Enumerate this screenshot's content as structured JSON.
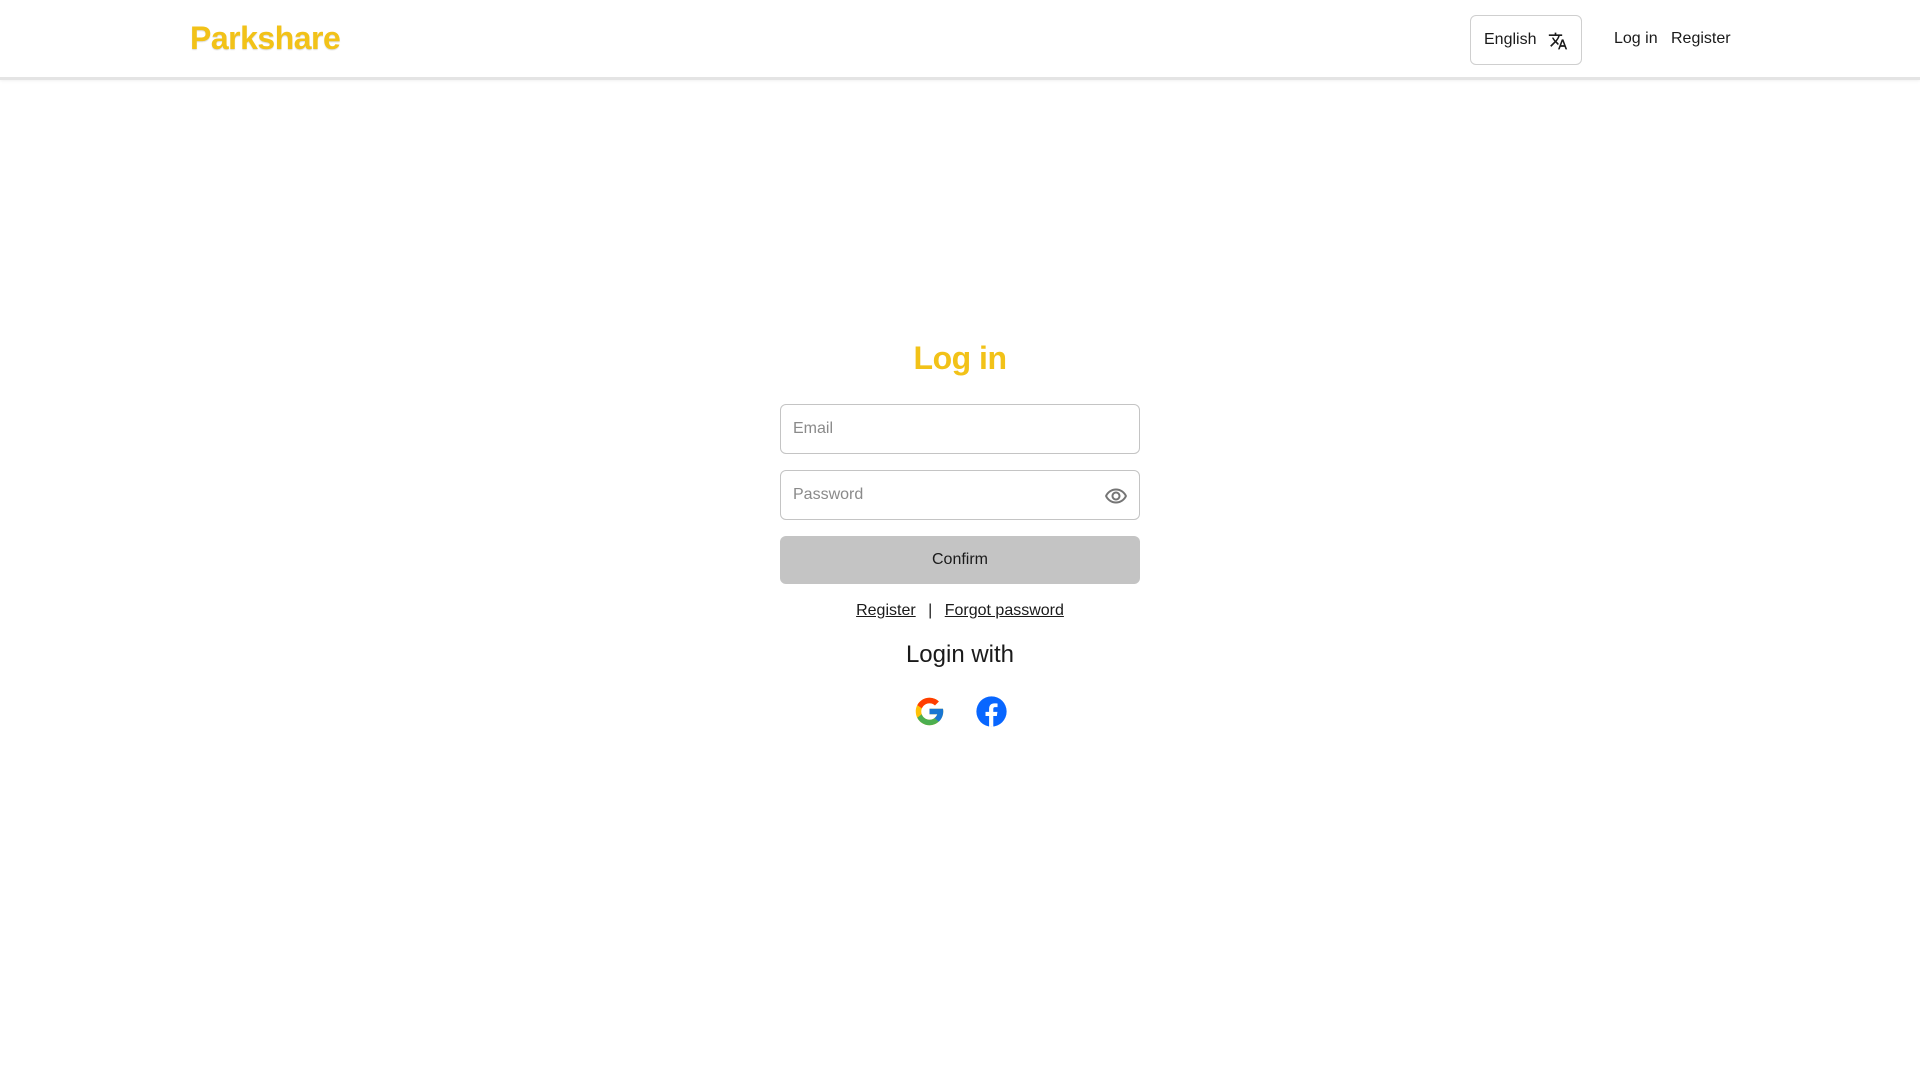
{
  "header": {
    "logo": "Parkshare",
    "language": {
      "selected": "English",
      "icon": "translate-icon"
    },
    "nav": {
      "login_label": "Log in",
      "register_label": "Register"
    }
  },
  "login": {
    "title": "Log in",
    "email": {
      "placeholder": "Email",
      "value": ""
    },
    "password": {
      "placeholder": "Password",
      "value": "",
      "toggle_icon": "eye-icon"
    },
    "confirm_label": "Confirm",
    "register_link": "Register",
    "separator": "|",
    "forgot_link": "Forgot password",
    "login_with_label": "Login with",
    "social": [
      {
        "name": "Google",
        "icon": "google-icon"
      },
      {
        "name": "Facebook",
        "icon": "facebook-icon"
      }
    ]
  },
  "colors": {
    "brand_yellow": "#f2c218",
    "button_gray": "#c4c4c4",
    "border_gray": "#c4c4c4",
    "facebook_blue": "#0866ff"
  }
}
